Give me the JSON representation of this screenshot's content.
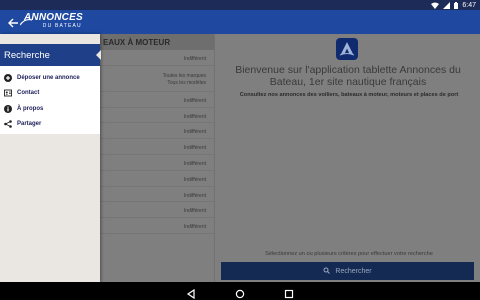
{
  "status_bar": {
    "time": "6:47",
    "colors": {
      "background": "#1c2b57"
    }
  },
  "app_bar": {
    "logo": {
      "main": "ANNONCES",
      "sub": "DU BATEAU"
    },
    "colors": {
      "background": "#1f49a0"
    }
  },
  "list": {
    "header": "EAUX À MOTEUR",
    "rows": [
      "Indifférent",
      "Toutes les marques\nTous les modèles",
      "Indifférent",
      "Indifférent",
      "Indifférent",
      "Indifférent",
      "Indifférent",
      "Indifférent",
      "Indifférent",
      "Indifférent",
      "Indifférent"
    ]
  },
  "welcome": {
    "title": "Bienvenue sur l'application tablette Annonces du Bateau, 1er site nautique français",
    "subtitle": "Consultez nos annonces des voiliers, bateaux à moteur, moteurs et places de port",
    "hint": "Sélectionnez un ou plusieurs critères pour effectuer votre recherche",
    "search_button": "Rechercher"
  },
  "drawer": {
    "active_item": "Recherche",
    "items": [
      {
        "label": "Déposer une annonce",
        "icon": "plus-circle-icon"
      },
      {
        "label": "Contact",
        "icon": "contact-card-icon"
      },
      {
        "label": "À propos",
        "icon": "info-icon"
      },
      {
        "label": "Partager",
        "icon": "share-icon"
      }
    ],
    "colors": {
      "active_background": "#1f3f88",
      "item_text": "#1e1e5a"
    }
  }
}
